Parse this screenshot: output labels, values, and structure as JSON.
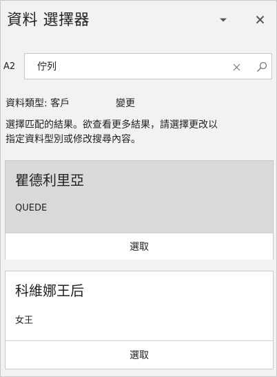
{
  "pane": {
    "title": "資料 選擇器",
    "dropdown_icon": "chevron-down-icon",
    "close_icon": "close-icon"
  },
  "search": {
    "cell_ref": "A2",
    "value": "佇列",
    "clear_icon": "clear-icon",
    "search_icon": "search-icon"
  },
  "data_type": {
    "label": "資料類型: 客戶",
    "change_link": "變更"
  },
  "description": "選擇匹配的結果。欲查看更多結果，請選擇更改以指定資料型別或修改搜尋內容。",
  "results": [
    {
      "title": "瞿德利里亞",
      "subtitle": "QUEDE",
      "select_label": "選取",
      "highlighted": true
    },
    {
      "title": "科維娜王后",
      "subtitle": "女王",
      "select_label": "選取",
      "highlighted": false
    }
  ],
  "colors": {
    "pane_background": "#f2f2f2",
    "highlighted_card": "#d9d9d9",
    "card_background": "#ffffff",
    "border": "#c8c8c8"
  }
}
